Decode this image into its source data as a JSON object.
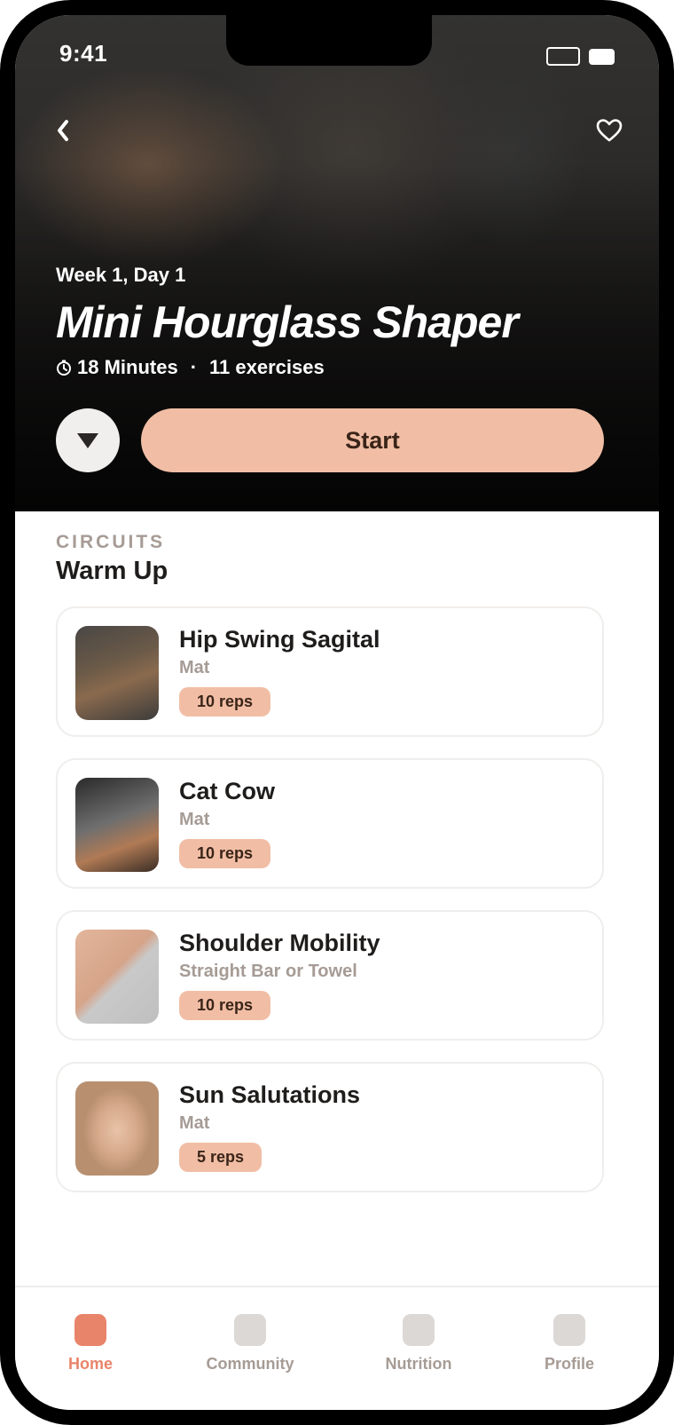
{
  "status_bar": {
    "time": "9:41"
  },
  "hero": {
    "subtitle": "Week 1, Day 1",
    "title": "Mini Hourglass Shaper",
    "duration": "18 Minutes",
    "separator": "·",
    "exercises": "11 exercises",
    "start_label": "Start"
  },
  "section": {
    "eyebrow": "CIRCUITS",
    "title": "Warm Up"
  },
  "exercises": [
    {
      "name": "Hip Swing Sagital",
      "equipment": "Mat",
      "reps": "10 reps"
    },
    {
      "name": "Cat Cow",
      "equipment": "Mat",
      "reps": "10 reps"
    },
    {
      "name": "Shoulder Mobility",
      "equipment": "Straight Bar or Towel",
      "reps": "10 reps"
    },
    {
      "name": "Sun Salutations",
      "equipment": "Mat",
      "reps": "5 reps"
    }
  ],
  "tabs": [
    {
      "label": "Home",
      "active": true
    },
    {
      "label": "Community",
      "active": false
    },
    {
      "label": "Nutrition",
      "active": false
    },
    {
      "label": "Profile",
      "active": false
    }
  ],
  "colors": {
    "accent": "#e8846a",
    "button_peach": "#f1bea5",
    "muted": "#a69b95"
  },
  "icons": {
    "back": "chevron-left-icon",
    "favorite": "heart-icon",
    "timer": "timer-icon",
    "collapse": "triangle-down-icon"
  }
}
